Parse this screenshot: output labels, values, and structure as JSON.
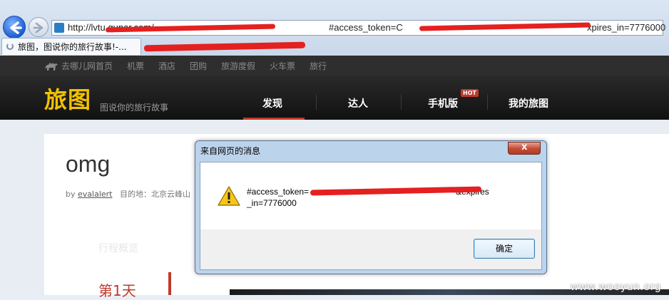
{
  "browser": {
    "url_prefix": "http://lvtu.",
    "url_domain": "qunar.com",
    "url_mid": "/",
    "url_token_part": "#access_token=C",
    "url_tail": "xpires_in=7776000",
    "tab_title": "旅图，图说你的旅行故事!-..."
  },
  "site": {
    "top_nav": [
      "去哪儿网首页",
      "机票",
      "酒店",
      "团购",
      "旅游度假",
      "火车票",
      "旅行"
    ],
    "logo": "旅图",
    "slogan": "图说你的旅行故事",
    "main_nav": [
      "发现",
      "达人",
      "手机版",
      "我的旅图"
    ],
    "hot_badge": "HOT"
  },
  "post": {
    "title": "omg",
    "by_label": "by",
    "author": "evalalert",
    "destination": "目的地：北京云峰山",
    "faded_heading": "行程概览",
    "day_label": "第1天"
  },
  "dialog": {
    "title": "来自网页的消息",
    "close_glyph": "x",
    "message_start": "#access_token=",
    "message_end": "&expires",
    "message_line2": "_in=7776000",
    "ok_label": "确定"
  },
  "watermark": "www.wooyun.org",
  "colors": {
    "accent_red": "#c0392b",
    "logo_yellow": "#f2c200",
    "redaction": "#e52020"
  }
}
